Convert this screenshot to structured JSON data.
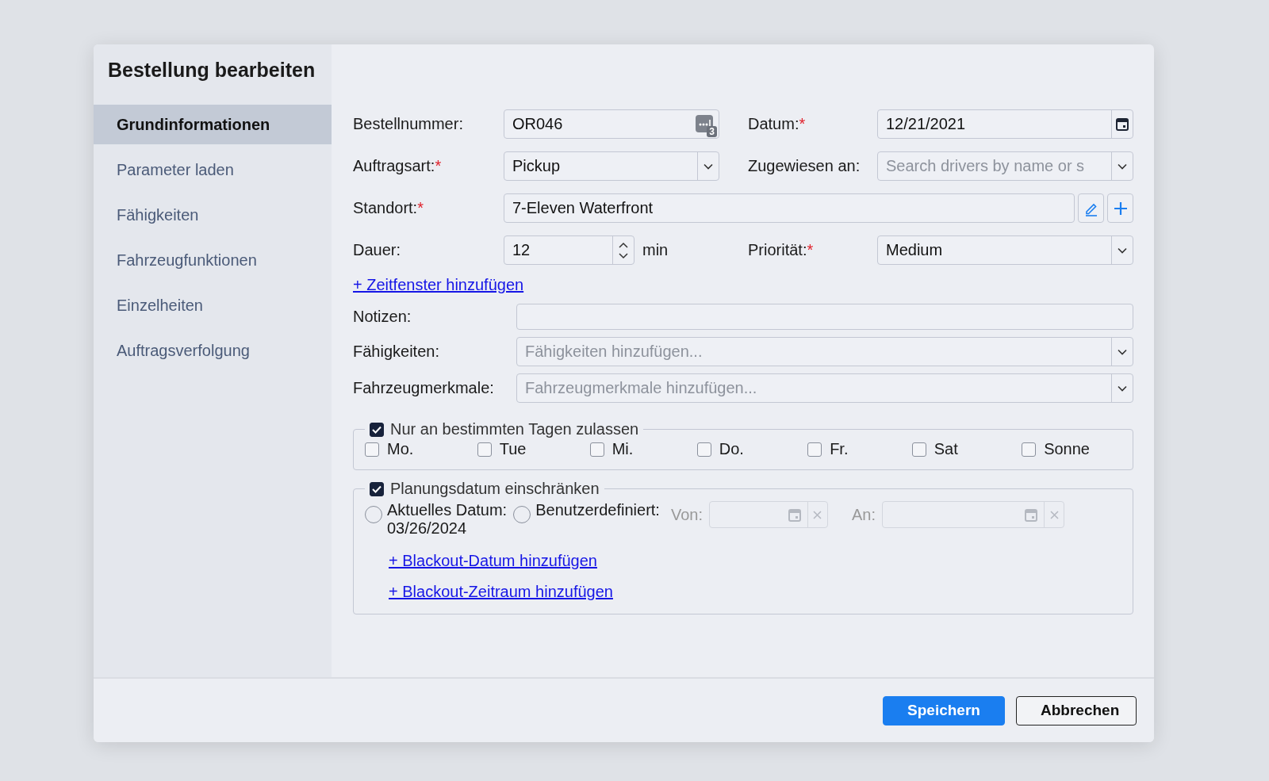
{
  "dialog": {
    "title": "Bestellung bearbeiten"
  },
  "sidebar": {
    "items": [
      {
        "label": "Grundinformationen",
        "selected": true
      },
      {
        "label": "Parameter laden",
        "selected": false
      },
      {
        "label": "Fähigkeiten",
        "selected": false
      },
      {
        "label": "Fahrzeugfunktionen",
        "selected": false
      },
      {
        "label": "Einzelheiten",
        "selected": false
      },
      {
        "label": "Auftragsverfolgung",
        "selected": false
      }
    ]
  },
  "form": {
    "order_number": {
      "label": "Bestellnummer:",
      "value": "OR046",
      "badge": "3"
    },
    "date": {
      "label": "Datum:",
      "required_mark": "*",
      "value": "12/21/2021"
    },
    "order_type": {
      "label": "Auftragsart:",
      "required_mark": "*",
      "value": "Pickup"
    },
    "assigned_to": {
      "label": "Zugewiesen an:",
      "placeholder": "Search drivers by name or s"
    },
    "location": {
      "label": "Standort:",
      "required_mark": "*",
      "value": "7-Eleven Waterfront"
    },
    "duration": {
      "label": "Dauer:",
      "value": "12",
      "unit": "min"
    },
    "priority": {
      "label": "Priorität:",
      "required_mark": "*",
      "value": "Medium"
    },
    "add_time_window": "+ Zeitfenster hinzufügen",
    "notes": {
      "label": "Notizen:"
    },
    "skills": {
      "label": "Fähigkeiten:",
      "placeholder": "Fähigkeiten hinzufügen..."
    },
    "vehicle_features": {
      "label": "Fahrzeugmerkmale:",
      "placeholder": "Fahrzeugmerkmale hinzufügen..."
    },
    "days_group": {
      "label": "Nur an bestimmten Tagen zulassen",
      "checked": true,
      "days": [
        {
          "label": "Mo.",
          "checked": false
        },
        {
          "label": "Tue",
          "checked": false
        },
        {
          "label": "Mi.",
          "checked": false
        },
        {
          "label": "Do.",
          "checked": false
        },
        {
          "label": "Fr.",
          "checked": false
        },
        {
          "label": "Sat",
          "checked": false
        },
        {
          "label": "Sonne",
          "checked": false
        }
      ]
    },
    "planning_group": {
      "label": "Planungsdatum einschränken",
      "checked": true,
      "options": [
        {
          "label": "Aktuelles Datum:",
          "sublabel": "03/26/2024",
          "selected": false
        },
        {
          "label": "Benutzerdefiniert:",
          "selected": false
        }
      ],
      "from": {
        "label": "Von:",
        "disabled": true
      },
      "to": {
        "label": "An:",
        "disabled": true
      },
      "links": [
        "+ Blackout-Datum hinzufügen",
        "+ Blackout-Zeitraum hinzufügen"
      ]
    }
  },
  "buttons": [
    {
      "label": "Speichern",
      "kind": "primary"
    },
    {
      "label": "Abbrechen",
      "kind": "secondary"
    }
  ]
}
